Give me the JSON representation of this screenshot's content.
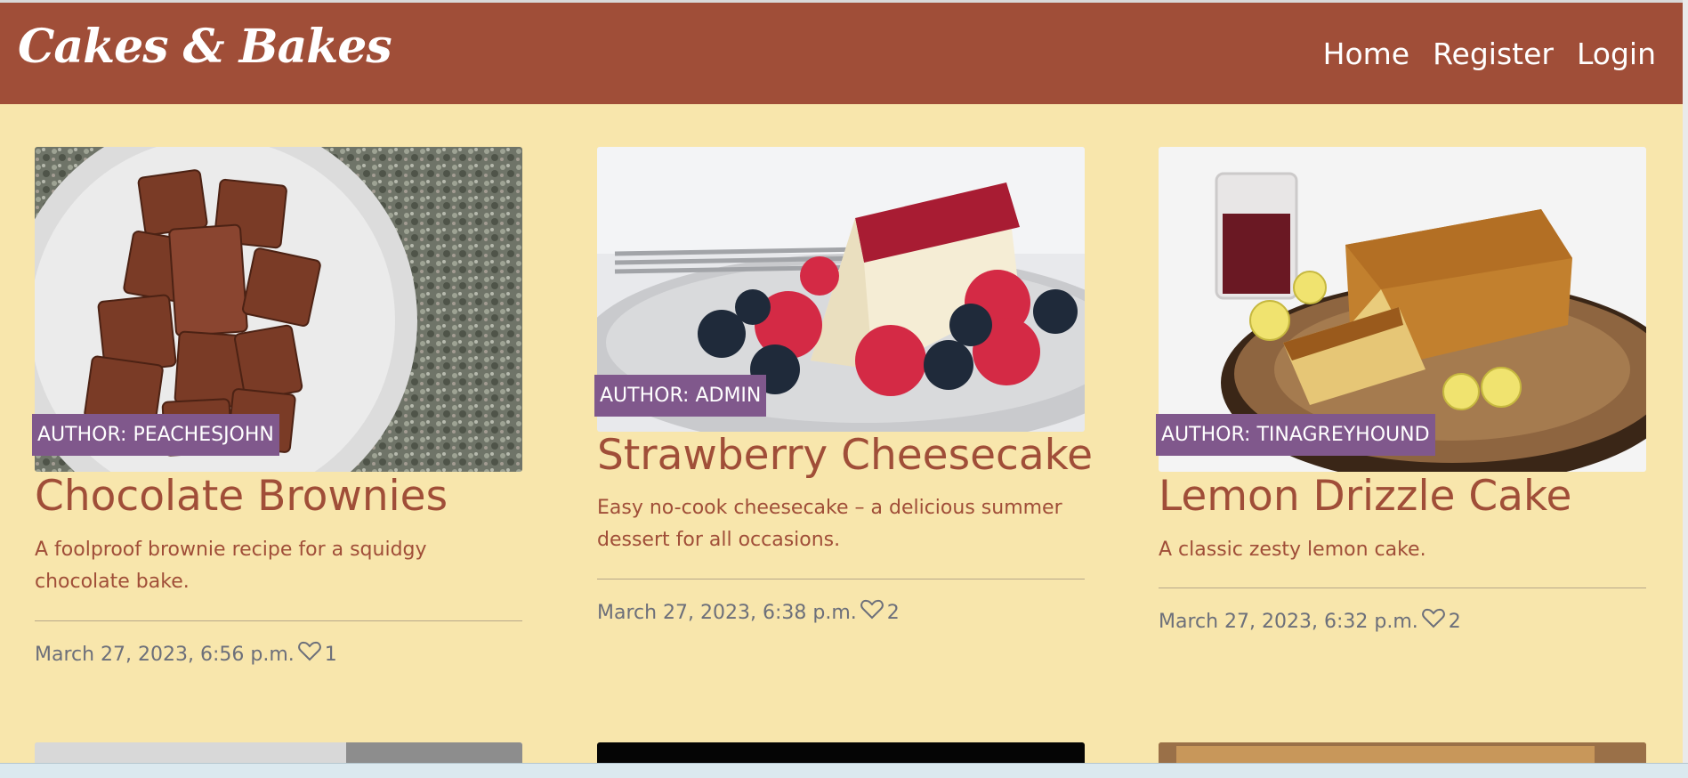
{
  "brand": "Cakes & Bakes",
  "nav": [
    "Home",
    "Register",
    "Login"
  ],
  "cards": [
    {
      "author": "AUTHOR: PEACHESJOHN",
      "title": "Chocolate Brownies",
      "excerpt": "A foolproof brownie recipe for a squidgy chocolate bake.",
      "date": "March 27, 2023, 6:56 p.m.",
      "likes": "1",
      "image": "chocolate-brownies-photo"
    },
    {
      "author": "AUTHOR: ADMIN",
      "title": "Strawberry Cheesecake",
      "excerpt": "Easy no-cook cheesecake – a delicious summer dessert for all occasions.",
      "date": "March 27, 2023, 6:38 p.m.",
      "likes": "2",
      "image": "strawberry-cheesecake-photo"
    },
    {
      "author": "AUTHOR: TINAGREYHOUND",
      "title": "Lemon Drizzle Cake",
      "excerpt": "A classic zesty lemon cake.",
      "date": "March 27, 2023, 6:32 p.m.",
      "likes": "2",
      "image": "lemon-drizzle-cake-photo"
    }
  ],
  "colors": {
    "navbar": "#a04e38",
    "background": "#f8e6ac",
    "badge": "#80588c",
    "title": "#a04e38",
    "meta": "#6c6f7a"
  }
}
